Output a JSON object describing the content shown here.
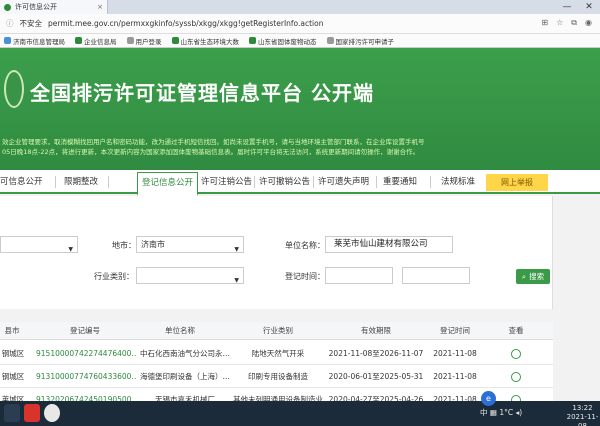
{
  "browser": {
    "tab_title": "许可信息公开",
    "tab_close": "×",
    "window_min": "—",
    "window_close": "✕",
    "security_label": "不安全",
    "url": "permit.mee.gov.cn/permxxgkinfo/syssb/xkgg/xkgg!getRegisterInfo.action",
    "bookmarks": [
      "济南市信息管理局",
      "企业信息局",
      "用户登录",
      "山东省生态环境大数",
      "山东省固体废物动态",
      "国家排污许可申请子"
    ]
  },
  "site": {
    "title": "全国排污许可证管理信息平台  公开端",
    "notice_lines": [
      "效企业管理要求，取消模糊找回用户名和密码功能，改为通过手机短信找回。如尚未设置手机号，请与当地环境主管部门联系，在企业库设置手机号",
      "05日晚18点-22点，将进行更新，本次更新内容为国家添加固体废物基础信息表。届时许可平台将无法访问，系统更新期间请勿操作，谢谢合作。"
    ]
  },
  "nav": {
    "items": [
      "可信息公开",
      "限期整改",
      "登记信息公开",
      "许可注销公告",
      "许可撤销公告",
      "许可遗失声明",
      "重要通知",
      "法规标准"
    ],
    "report_label": "网上举报"
  },
  "filters": {
    "city_label": "地市：",
    "city_value": "济南市",
    "unit_label": "单位名称：",
    "unit_value": "莱芜市仙山建材有限公司",
    "industry_label": "行业类别：",
    "time_label": "登记时间：",
    "search_label": "搜索"
  },
  "table": {
    "headers": [
      "县市",
      "登记编号",
      "单位名称",
      "行业类别",
      "有效期限",
      "登记时间",
      "查看"
    ],
    "rows": [
      [
        "钢城区",
        "91510000742274476400…",
        "中石化西南油气分公司永…",
        "陆地天然气开采",
        "2021-11-08至2026-11-07",
        "2021-11-08"
      ],
      [
        "钢城区",
        "91310000774760433600…",
        "海德堡印刷设备（上海）…",
        "印刷专用设备制造",
        "2020-06-01至2025-05-31",
        "2021-11-08"
      ],
      [
        "莱城区",
        "91320206742450190500…",
        "无锡市嘉禾机械厂",
        "其他未列明通用设备制造业",
        "2020-04-27至2025-04-26",
        "2021-11-08"
      ]
    ]
  },
  "taskbar": {
    "weather": "1°C",
    "clock_time": "13:22",
    "clock_date": "2021-11-08"
  },
  "colors": {
    "brand_green": "#3a9a48",
    "report_yellow": "#ffd54a"
  }
}
